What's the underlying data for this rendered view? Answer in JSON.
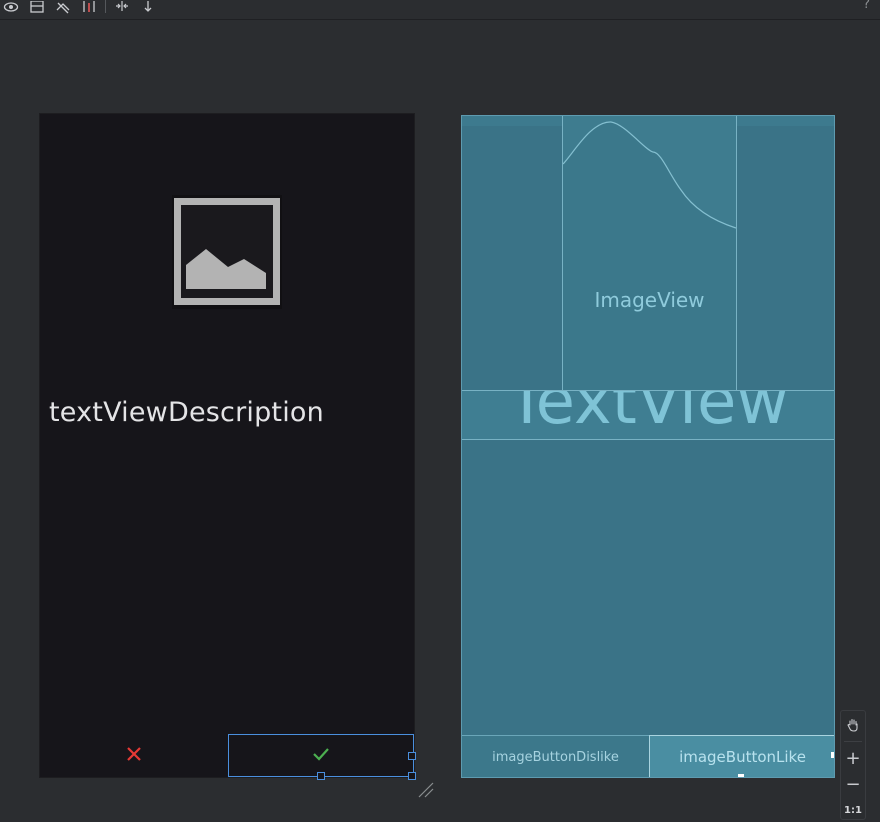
{
  "toolbar": {
    "icons": [
      "eye-icon",
      "layout-icon",
      "blueprint-icon",
      "error-icon",
      "pan-icon",
      "arrow-down-icon"
    ],
    "help_label": "?"
  },
  "design": {
    "description_text": "textViewDescription",
    "dislike_glyph": "✕",
    "like_glyph": "✓",
    "colors": {
      "background": "#16151a",
      "dislike": "#e53935",
      "like": "#4caf50",
      "selection": "#4a8fde"
    }
  },
  "blueprint": {
    "imageview_label": "ImageView",
    "textview_label": "TextView",
    "dislike_label": "imageButtonDislike",
    "like_label": "imageButtonLike",
    "colors": {
      "background": "#3a7387",
      "outline": "#78b2c4"
    }
  },
  "zoom": {
    "zoom_in": "+",
    "zoom_out": "−",
    "reset_label": "1:1"
  }
}
